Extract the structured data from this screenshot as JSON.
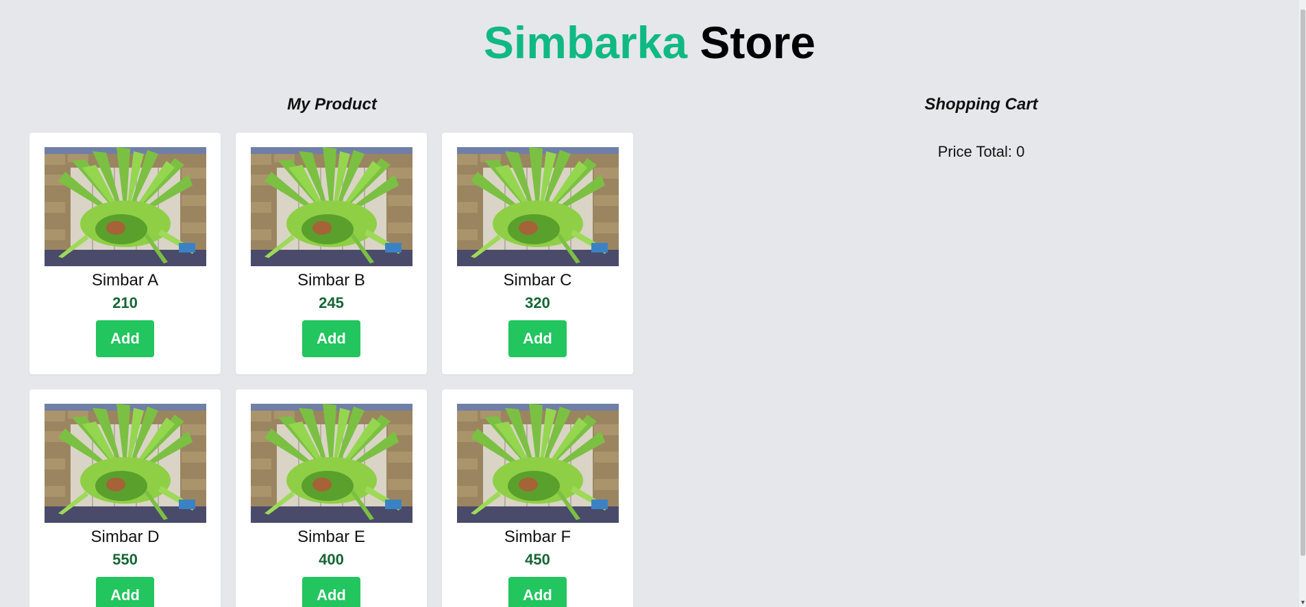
{
  "header": {
    "brand": "Simbarka",
    "store": "Store"
  },
  "products_section": {
    "title": "My Product"
  },
  "cart_section": {
    "title": "Shopping Cart",
    "total_label": "Price Total: 0"
  },
  "products": [
    {
      "name": "Simbar A",
      "price": "210",
      "button": "Add"
    },
    {
      "name": "Simbar B",
      "price": "245",
      "button": "Add"
    },
    {
      "name": "Simbar C",
      "price": "320",
      "button": "Add"
    },
    {
      "name": "Simbar D",
      "price": "550",
      "button": "Add"
    },
    {
      "name": "Simbar E",
      "price": "400",
      "button": "Add"
    },
    {
      "name": "Simbar F",
      "price": "450",
      "button": "Add"
    }
  ],
  "colors": {
    "brand": "#10b981",
    "price": "#166534",
    "button": "#22c55e",
    "background": "#e5e7eb"
  },
  "icons": {
    "scroll_down": "chevron-down-icon"
  }
}
